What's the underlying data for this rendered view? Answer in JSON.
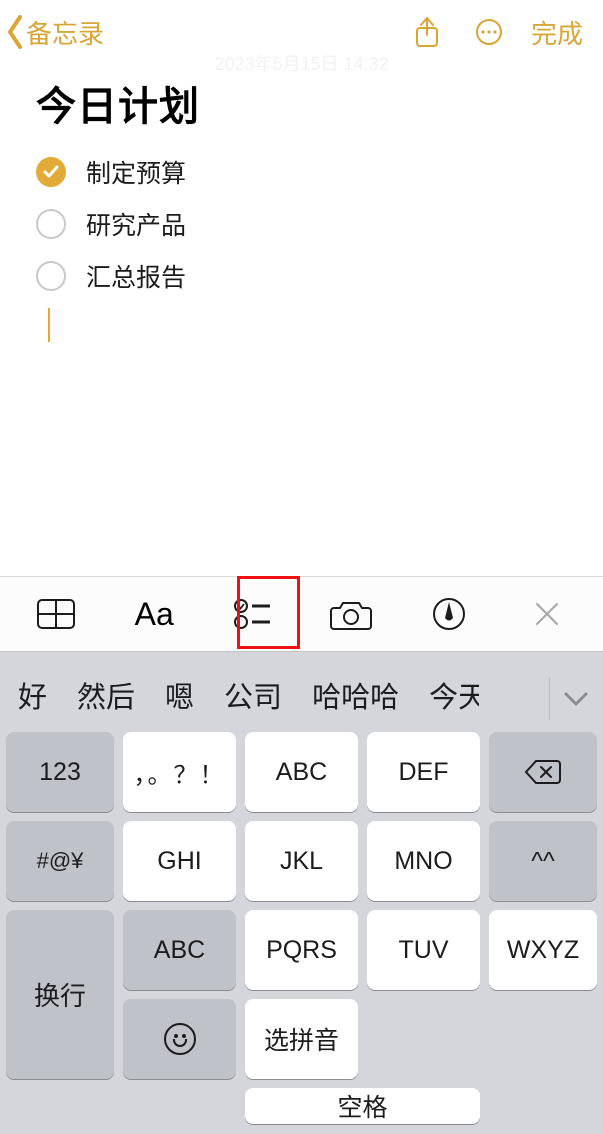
{
  "nav": {
    "back_label": "备忘录",
    "done_label": "完成"
  },
  "timestamp": "2023年5月15日 14:32",
  "note": {
    "title": "今日计划",
    "items": [
      {
        "text": "制定预算",
        "checked": true
      },
      {
        "text": "研究产品",
        "checked": false
      },
      {
        "text": "汇总报告",
        "checked": false
      }
    ]
  },
  "format_toolbar": {
    "table": "table",
    "text_style": "Aa",
    "checklist": "checklist",
    "camera": "camera",
    "markup": "markup",
    "close": "close"
  },
  "keyboard": {
    "candidates": [
      "好",
      "然后",
      "嗯",
      "公司",
      "哈哈哈",
      "今天"
    ],
    "keys": {
      "num": "123",
      "punct": "，。？！",
      "abc": "ABC",
      "def": "DEF",
      "symbols": "#@¥",
      "ghi": "GHI",
      "jkl": "JKL",
      "mno": "MNO",
      "face": "^^",
      "switch_abc": "ABC",
      "pqrs": "PQRS",
      "tuv": "TUV",
      "wxyz": "WXYZ",
      "enter": "换行",
      "select_pinyin": "选拼音",
      "space": "空格"
    }
  }
}
